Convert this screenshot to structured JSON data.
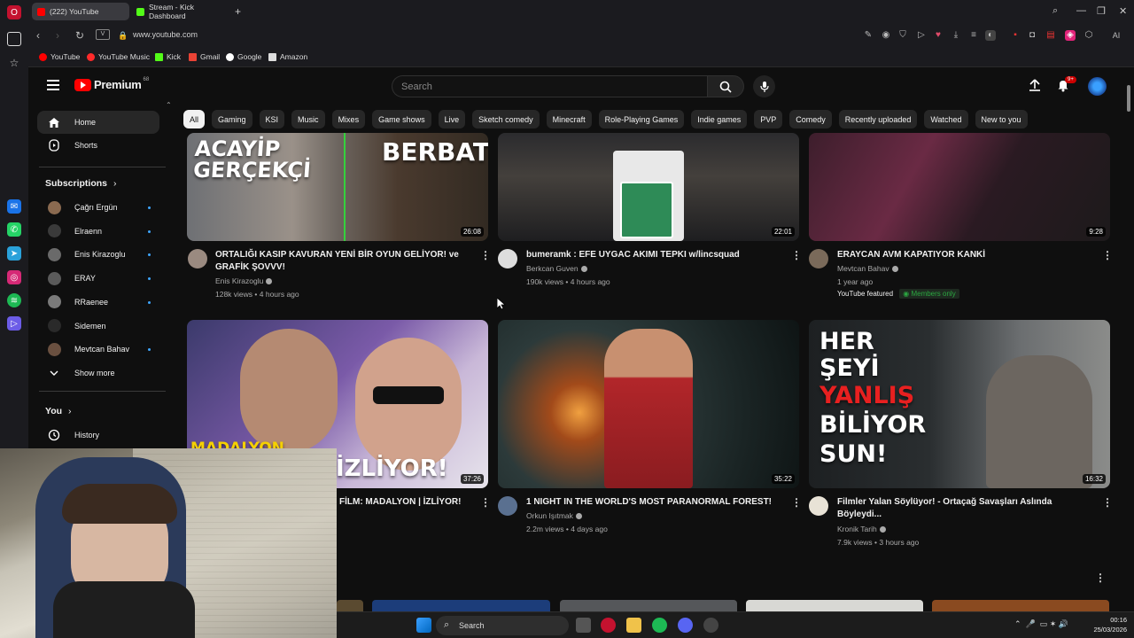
{
  "browser": {
    "tabs": [
      {
        "label": "(222) YouTube",
        "active": true
      },
      {
        "label": "Stream - Kick Dashboard",
        "active": false
      }
    ],
    "new_tab_label": "+",
    "url": "www.youtube.com",
    "bookmarks": [
      "YouTube",
      "YouTube Music",
      "Kick",
      "Gmail",
      "Google",
      "Amazon"
    ],
    "ai_label": "AI"
  },
  "header": {
    "brand": "Premium",
    "brand_sup": "68",
    "search_placeholder": "Search",
    "notifications": "9+"
  },
  "chips": [
    "All",
    "Gaming",
    "KSI",
    "Music",
    "Mixes",
    "Game shows",
    "Live",
    "Sketch comedy",
    "Minecraft",
    "Role-Playing Games",
    "Indie games",
    "PVP",
    "Comedy",
    "Recently uploaded",
    "Watched",
    "New to you"
  ],
  "guide": {
    "home": "Home",
    "shorts": "Shorts",
    "subscriptions_title": "Subscriptions",
    "subscriptions": [
      "Çağrı Ergün",
      "Elraenn",
      "Enis Kirazoglu",
      "ERAY",
      "RRaenee",
      "Sidemen",
      "Mevtcan Bahav"
    ],
    "show_more": "Show more",
    "you_title": "You",
    "history": "History"
  },
  "videos": [
    {
      "title": "ORTALIĞI KASIP KAVURAN YENİ BİR OYUN GELİYOR! ve GRAFİK ŞOVVV!",
      "channel": "Enis Kirazoglu",
      "meta": "128k views • 4 hours ago",
      "duration": "26:08",
      "thumb_text_1": "ACAYİP\nGERÇEKÇİ",
      "thumb_text_2": "BERBAT!"
    },
    {
      "title": "bumeramk : EFE UYGAC AKIMI TEPKI w/lincsquad",
      "channel": "Berkcan Guven",
      "meta": "190k views • 4 hours ago",
      "duration": "22:01"
    },
    {
      "title": "ERAYCAN AVM KAPATIYOR KANKİ",
      "channel": "Mevtcan Bahav",
      "meta": "1 year ago",
      "duration": "9:28",
      "featured": "YouTube featured",
      "members": "Members only"
    },
    {
      "title": "FİLM: MADALYON | İZLİYOR!",
      "channel": "",
      "meta": "",
      "duration": "37:26",
      "thumb_text_1": "MADALYON",
      "thumb_text_2": "İZLİYOR!"
    },
    {
      "title": "1 NIGHT IN THE WORLD'S MOST PARANORMAL FOREST!",
      "channel": "Orkun Işıtmak",
      "meta": "2.2m views • 4 days ago",
      "duration": "35:22"
    },
    {
      "title": "Filmler Yalan Söylüyor! - Ortaçağ Savaşları Aslında Böyleydi...",
      "channel": "Kronik Tarih",
      "meta": "7.9k views • 3 hours ago",
      "duration": "16:32",
      "thumb_text_1": "HER\nŞEYİ",
      "thumb_text_red": "YANLIŞ",
      "thumb_text_2": "BİLİYOR\nSUN!"
    }
  ],
  "taskbar": {
    "search_label": "Search",
    "time": "00:16",
    "date": "25/03/2026"
  },
  "colors": {
    "accent": "#ff0000",
    "chip_active": "#f1f1f1",
    "link_blue": "#3ea6ff",
    "members_green": "#2ba640"
  }
}
